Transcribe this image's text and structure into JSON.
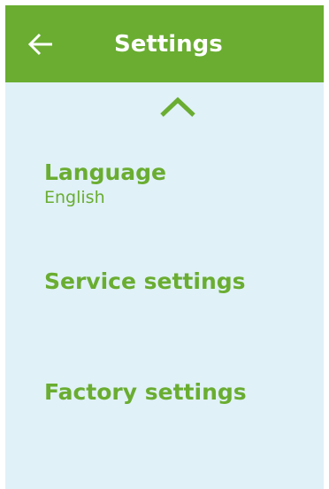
{
  "colors": {
    "header_bg": "#6aad31",
    "accent": "#6aad31",
    "screen_bg": "#e0f1f8",
    "header_text": "#ffffff"
  },
  "header": {
    "back_icon": "arrow-left-icon",
    "title": "Settings"
  },
  "scroll": {
    "up_icon": "chevron-up-icon"
  },
  "menu": {
    "items": [
      {
        "label": "Language",
        "value": "English"
      },
      {
        "label": "Service settings"
      },
      {
        "label": "Factory settings"
      }
    ]
  }
}
